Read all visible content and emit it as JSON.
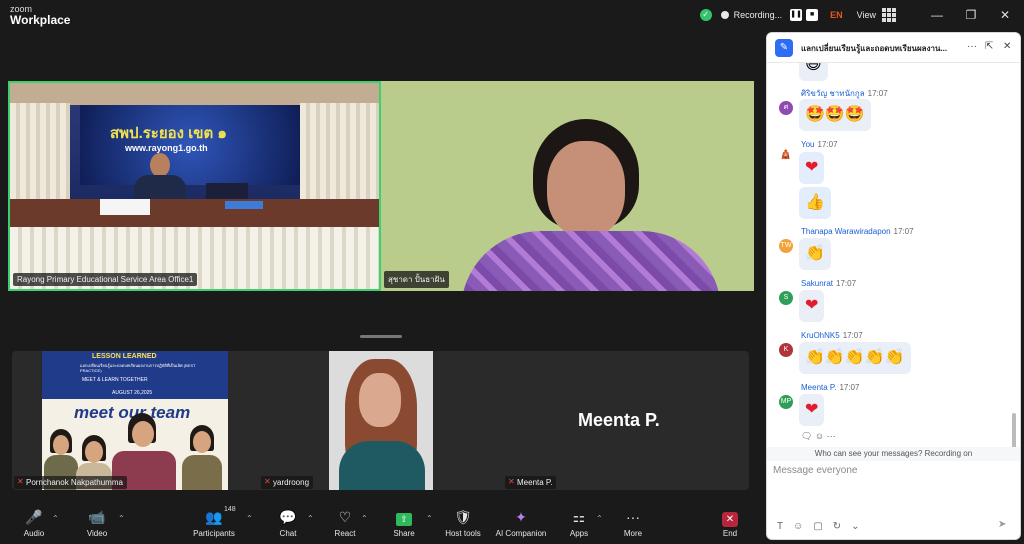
{
  "titlebar": {
    "brand_top": "zoom",
    "brand_bottom": "Workplace",
    "recording": "Recording...",
    "lang": "EN",
    "view": "View",
    "minimize": "—",
    "restore": "❐",
    "close": "✕"
  },
  "videos": {
    "main_left": {
      "name": "Rayong Primary Educational Service Area Office1",
      "banner_title": "สพป.ระยอง เขต ๑",
      "banner_url": "www.rayong1.go.th"
    },
    "main_right": {
      "name": "สุชาดา ปั้นธาฝัน"
    },
    "strip": [
      {
        "name": "Pornchanok Nakpathumma"
      },
      {
        "name": "yardroong"
      },
      {
        "name": "Meenta P."
      }
    ],
    "meenta_label": "Meenta P.",
    "slide": {
      "title": "LESSON LEARNED",
      "subtitle": "แลกเปลี่ยนเรียนรู้และถอดบทเรียนผลงานการปฏิบัติที่เป็นเลิศ (BEST PRACTICE)",
      "tagline": "MEET & LEARN TOGETHER",
      "date": "AUGUST 26,2025",
      "meet": "meet our team"
    }
  },
  "chat": {
    "title": "แลกเปลี่ยนเรียนรู้และถอดบทเรียนผลงาน...",
    "more": "···",
    "popout": "⇱",
    "close": "✕",
    "messages": [
      {
        "sender": "",
        "time": "",
        "content": "😄",
        "avatar": "",
        "color": "#ffffff"
      },
      {
        "sender": "ศิริขวัญ ชาทนักกูล",
        "time": "17:07",
        "content": "🤩🤩🤩",
        "avatar": "ศ",
        "color": "#8e4bb0"
      },
      {
        "sender": "You",
        "time": "17:07",
        "content": "❤",
        "avatar": "🛕",
        "color": "#ffffff"
      },
      {
        "sender": "",
        "time": "",
        "content": "👍",
        "avatar": "",
        "color": "#ffffff"
      },
      {
        "sender": "Thanapa Warawiradapon",
        "time": "17:07",
        "content": "👏",
        "avatar": "TW",
        "color": "#f2a23a"
      },
      {
        "sender": "Sakunrat",
        "time": "17:07",
        "content": "❤",
        "avatar": "S",
        "color": "#2f9e58"
      },
      {
        "sender": "KruOhNK5",
        "time": "17:07",
        "content": "👏👏👏👏👏",
        "avatar": "K",
        "color": "#b2343a"
      },
      {
        "sender": "Meenta P.",
        "time": "17:07",
        "content": "❤",
        "avatar": "MP",
        "color": "#2f9e58"
      }
    ],
    "react_icons": "🗨 ☺ ···",
    "privacy": "Who can see your messages? Recording on",
    "placeholder": "Message everyone",
    "tools": [
      "T",
      "☺",
      "▢",
      "↻",
      "⌄"
    ],
    "send": "➤"
  },
  "toolbar": {
    "items": [
      {
        "label": "Audio",
        "icon": "🎤"
      },
      {
        "label": "Video",
        "icon": "📹"
      },
      {
        "label": "Participants",
        "icon": "👥"
      },
      {
        "label": "Chat",
        "icon": "💬"
      },
      {
        "label": "React",
        "icon": "♡"
      },
      {
        "label": "Share",
        "icon": "⇧"
      },
      {
        "label": "Host tools",
        "icon": "🛡"
      },
      {
        "label": "AI Companion",
        "icon": "✦"
      },
      {
        "label": "Apps",
        "icon": "⚏"
      },
      {
        "label": "More",
        "icon": "···"
      },
      {
        "label": "End",
        "icon": "✕"
      }
    ],
    "participants_count": "148"
  },
  "colors": {
    "accent": "#2d6df6",
    "active_speaker": "#3bd16f",
    "end": "#b8263c",
    "share": "#2fb85c"
  }
}
